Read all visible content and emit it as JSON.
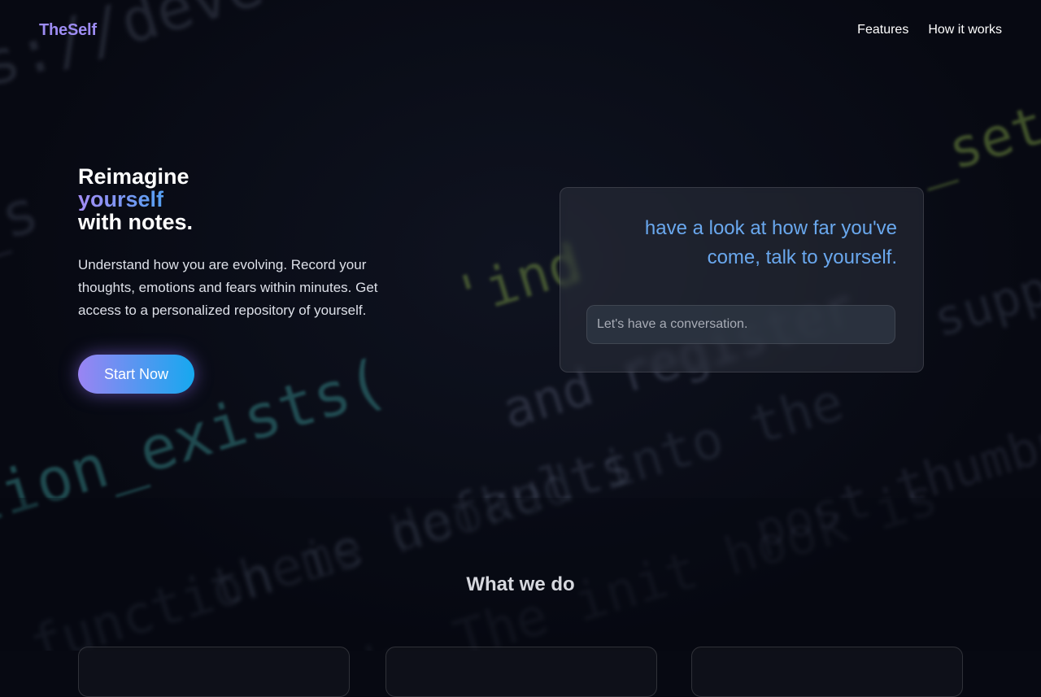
{
  "header": {
    "logo": "TheSelf",
    "nav": [
      "Features",
      "How it works"
    ]
  },
  "hero": {
    "title_line1": "Reimagine",
    "title_line2": "yourself",
    "title_line3": "with notes.",
    "description": "Understand how you are evolving. Record your thoughts, emotions and fears within minutes. Get access to a personalized repository of yourself.",
    "cta_label": "Start Now"
  },
  "chat_card": {
    "text": "have a look at how far you've come, talk to yourself.",
    "input_placeholder": "Let's have a conversation."
  },
  "section": {
    "title": "What we do"
  },
  "colors": {
    "background": "#070912",
    "logo": "#9d8cf2",
    "gradient_start": "#a48df6",
    "gradient_end": "#16a8ef",
    "card_text": "#6aa8ee"
  }
}
